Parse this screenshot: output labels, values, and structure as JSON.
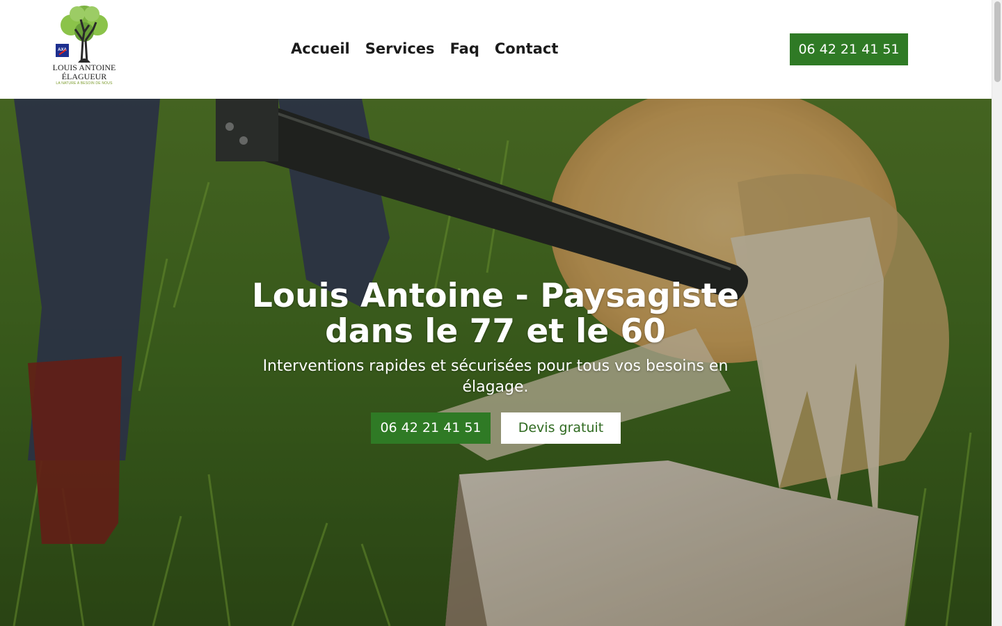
{
  "brand": {
    "line1": "LOUIS ANTOINE",
    "line2": "ÉLAGUEUR",
    "tagline": "LA NATURE A BESOIN DE NOUS",
    "badge": "AXA",
    "logo_icon": "tree-logo-icon"
  },
  "nav": {
    "items": [
      {
        "label": "Accueil"
      },
      {
        "label": "Services"
      },
      {
        "label": "Faq"
      },
      {
        "label": "Contact"
      }
    ]
  },
  "header": {
    "phone_label": "06 42 21 41 51"
  },
  "hero": {
    "title_line1": "Louis Antoine - Paysagiste",
    "title_line2": "dans le 77 et le 60",
    "subtitle": "Interventions rapides et sécurisées pour tous vos besoins en élagage.",
    "phone_button": "06 42 21 41 51",
    "quote_button": "Devis gratuit"
  },
  "colors": {
    "accent_green": "#2f7a25",
    "text_dark": "#1b1b1b",
    "white": "#ffffff"
  }
}
